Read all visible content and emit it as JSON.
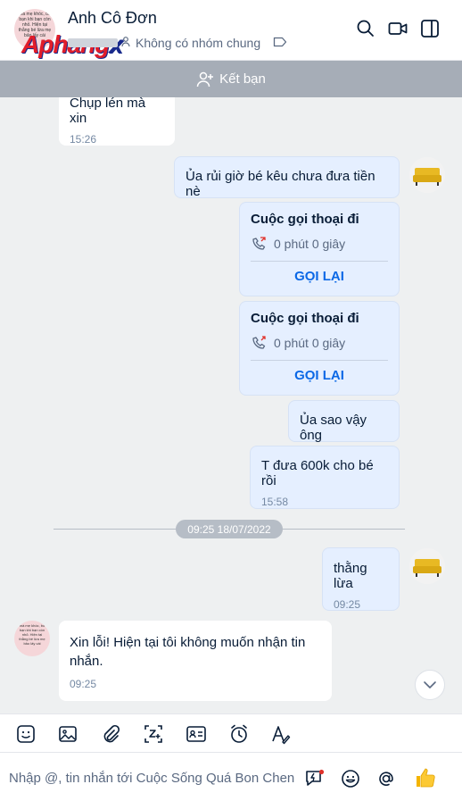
{
  "header": {
    "contact_name": "Anh Cô Đơn",
    "mutual_groups": "Không có nhóm chung",
    "watermark": "Aphangx",
    "avatar_text": "mà mẹ khóc, bố bạn khi bạn còn nhỏ. Hiện tại thằng bé lừa mẹ bảo lấy cái"
  },
  "friend_bar": {
    "label": "Kết bạn"
  },
  "messages": [
    {
      "text": "Chụp lén mà xin",
      "time": "15:26"
    },
    {
      "text": "Ủa rủi giờ bé kêu chưa đưa tiền nè"
    },
    {
      "title": "Cuộc gọi thoại đi",
      "duration": "0 phút 0 giây",
      "action": "GỌI LẠI"
    },
    {
      "title": "Cuộc gọi thoại đi",
      "duration": "0 phút 0 giây",
      "action": "GỌI LẠI"
    },
    {
      "text": "Ủa sao vậy ông"
    },
    {
      "text": "T đưa 600k cho bé rồi",
      "time": "15:58"
    },
    {
      "text": "thằng lừa",
      "time": "09:25"
    },
    {
      "text": "Xin lỗi! Hiện tại tôi không muốn nhận tin nhắn.",
      "time": "09:25"
    }
  ],
  "date_separator": "09:25 18/07/2022",
  "composer": {
    "placeholder": "Nhập @, tin nhắn tới Cuộc Sống Quá Bon Chen"
  },
  "toolbar_icons": [
    "sticker-icon",
    "image-icon",
    "attachment-icon",
    "screenshot-icon",
    "contact-card-icon",
    "reminder-icon",
    "text-format-icon"
  ],
  "colors": {
    "accent": "#0b68e6",
    "sent_bubble": "#e5efff",
    "chat_bg": "#eef0f1",
    "friend_bar": "#a6adb7"
  }
}
